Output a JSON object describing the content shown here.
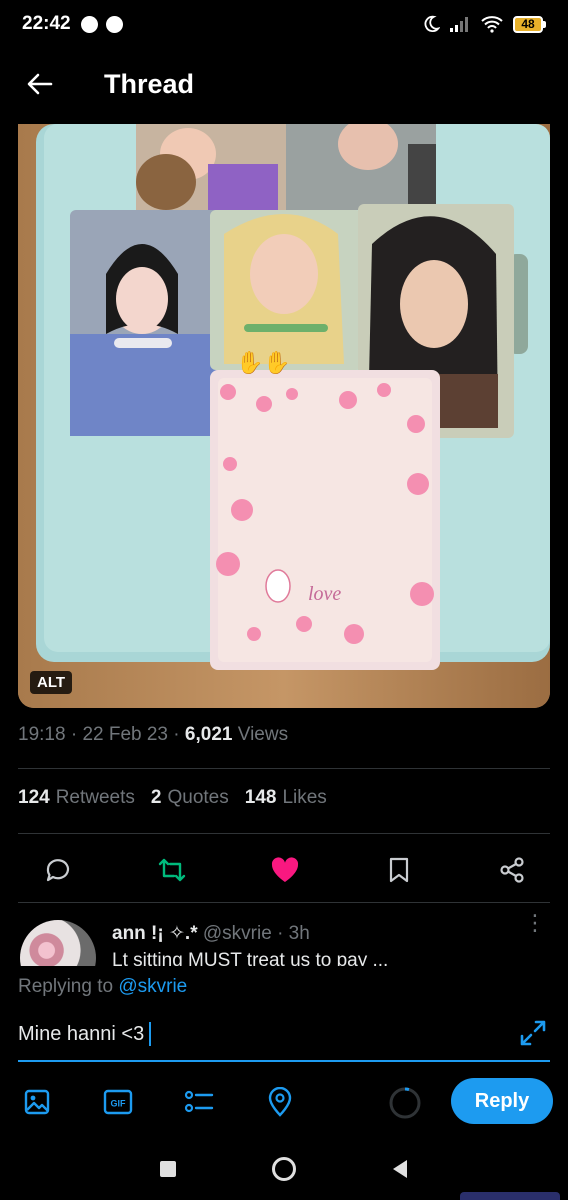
{
  "status_bar": {
    "time": "22:42",
    "battery": "48"
  },
  "header": {
    "title": "Thread"
  },
  "media": {
    "alt_label": "ALT"
  },
  "tweet_meta": {
    "time": "19:18",
    "separator": "·",
    "date": "22 Feb 23",
    "views_count": "6,021",
    "views_label": "Views"
  },
  "stats": {
    "retweets_count": "124",
    "retweets_label": "Retweets",
    "quotes_count": "2",
    "quotes_label": "Quotes",
    "likes_count": "148",
    "likes_label": "Likes"
  },
  "reply_preview": {
    "name": "ann !¡ ✧.*",
    "handle": "@skvrie",
    "separator": "·",
    "time": "3h",
    "text": "Lt sitting MUST treat us to pay ..."
  },
  "compose": {
    "replying_prefix": "Replying to",
    "replying_to": "@skvrie",
    "input_value": "Mine hanni <3",
    "reply_button": "Reply",
    "gif_label": "GIF"
  },
  "colors": {
    "accent": "#1d9bf0",
    "like": "#f91880",
    "retweet": "#00ba7c",
    "muted": "#71767b"
  },
  "icons": [
    "back-arrow-icon",
    "reply-icon",
    "retweet-icon",
    "heart-icon",
    "bookmark-icon",
    "share-icon",
    "image-icon",
    "gif-icon",
    "poll-icon",
    "location-icon",
    "expand-icon"
  ]
}
